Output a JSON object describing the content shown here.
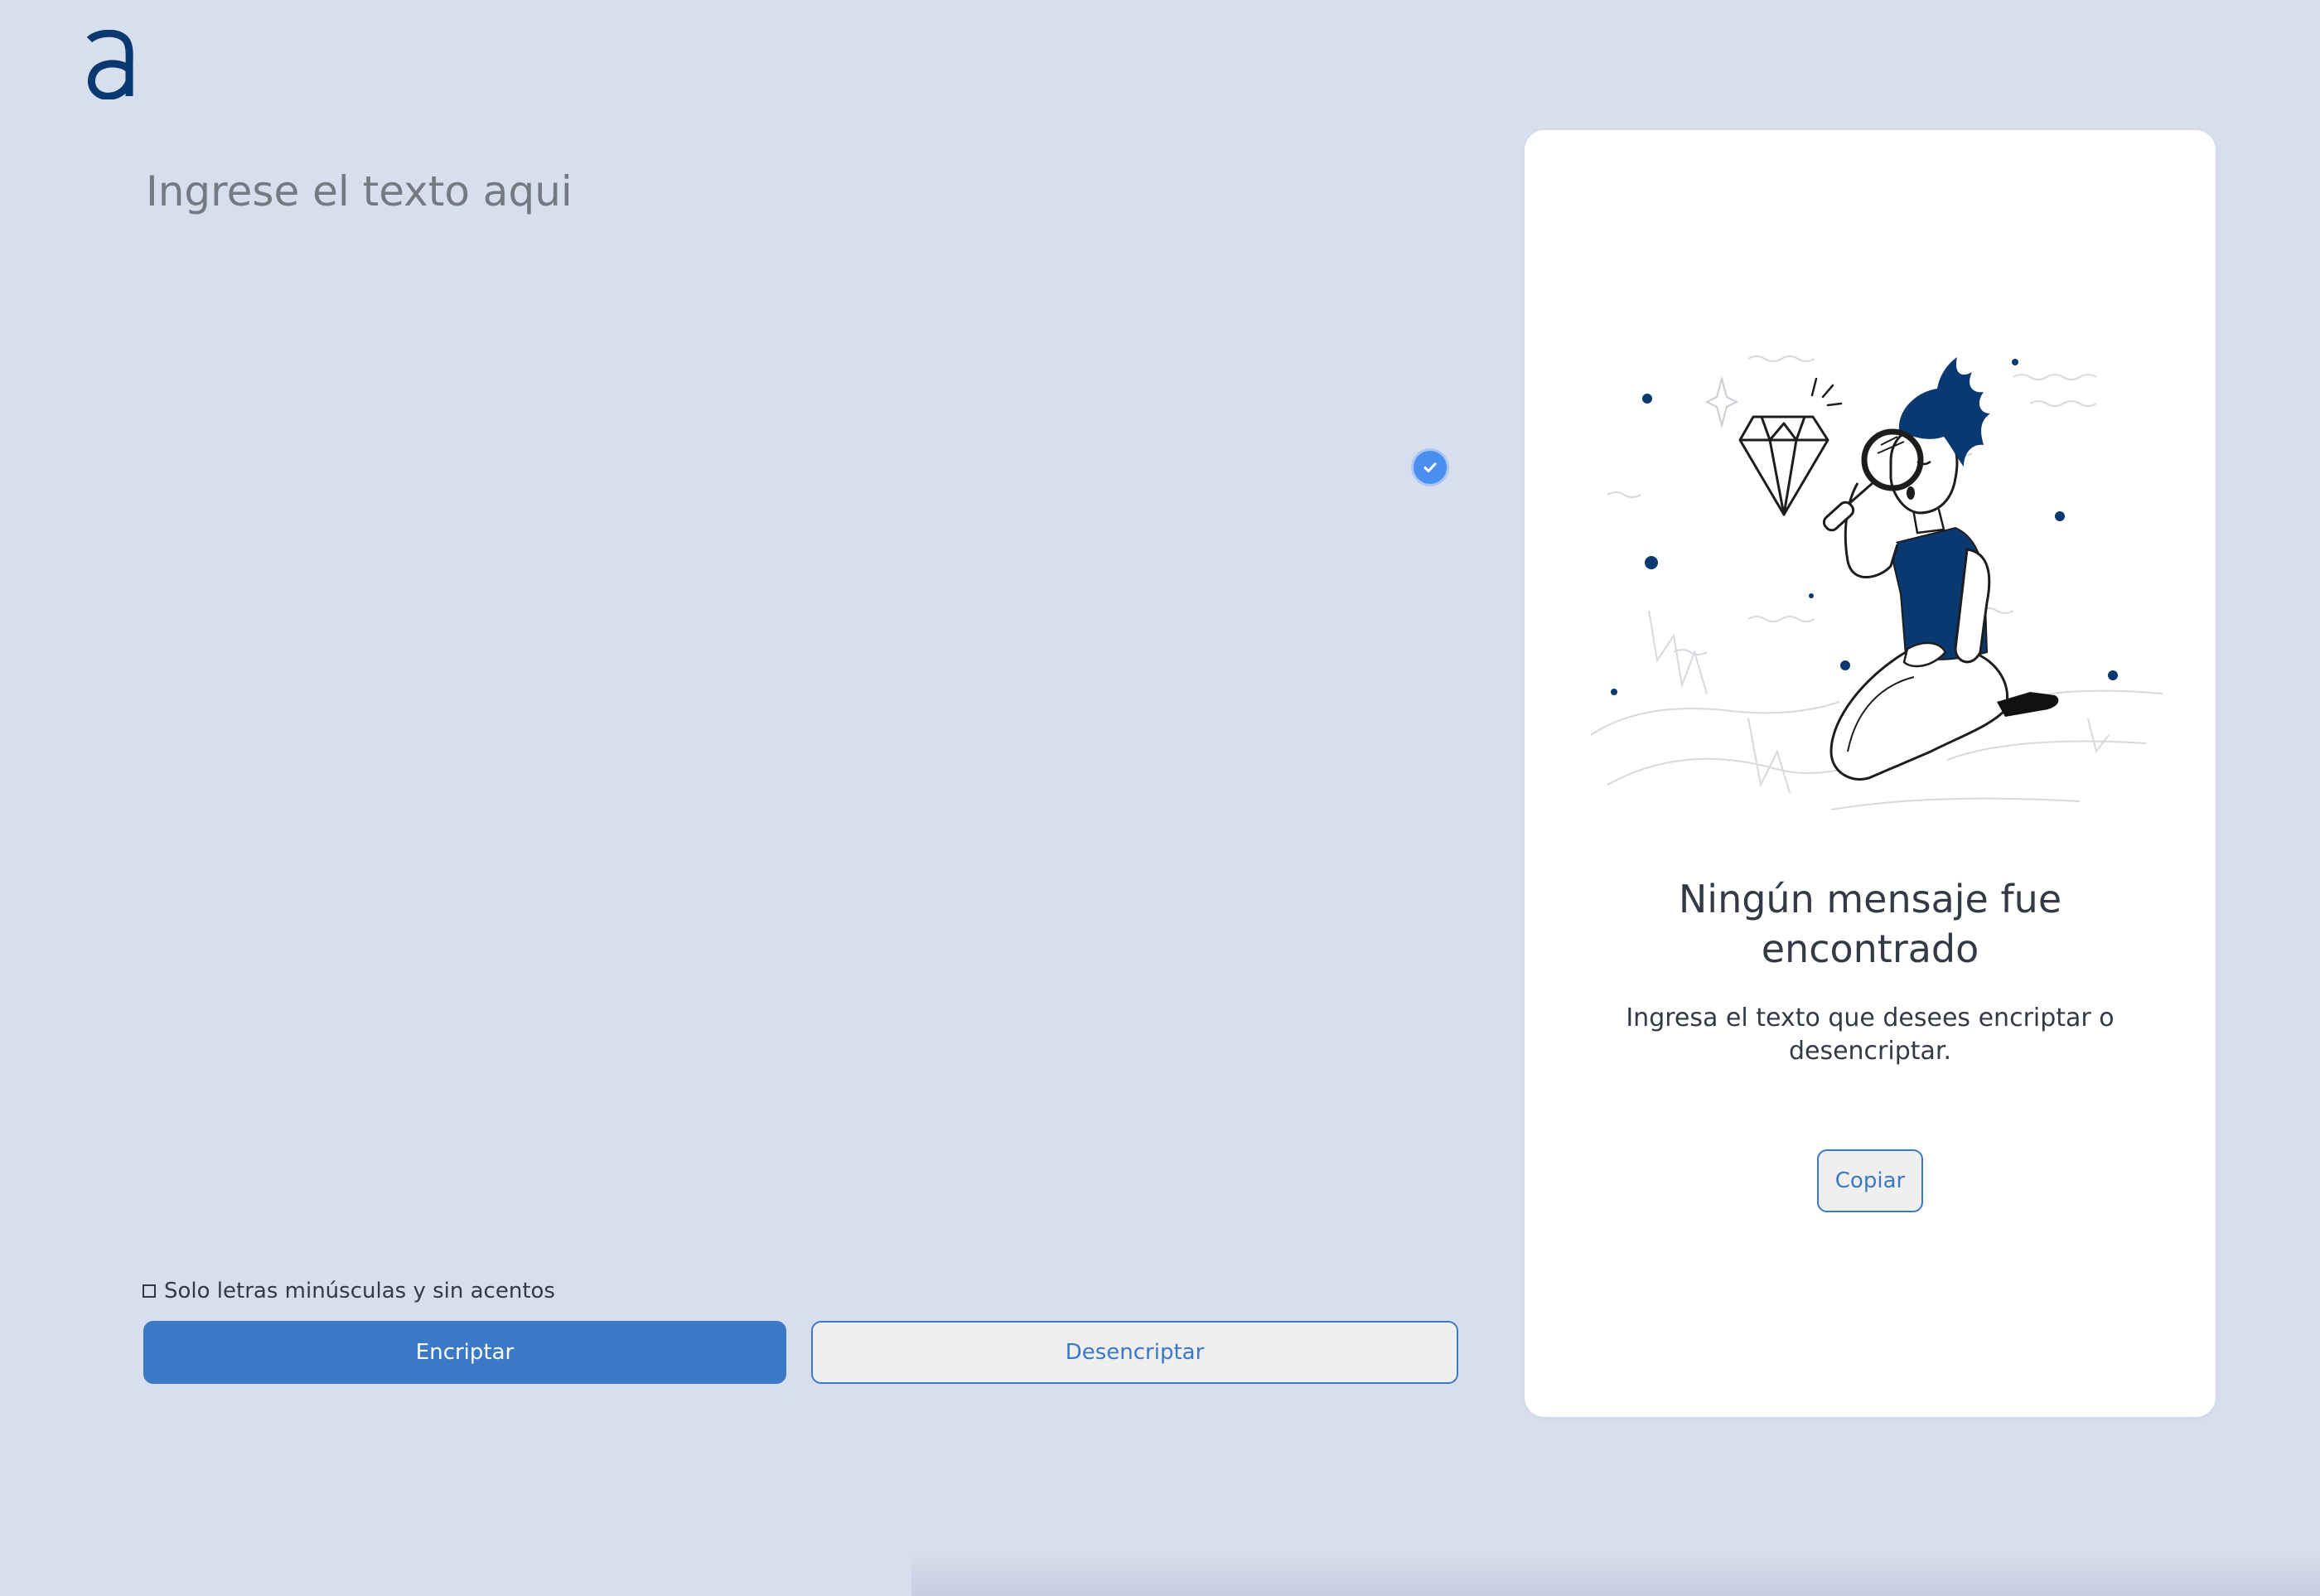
{
  "app": {
    "logo_letter": "a"
  },
  "input": {
    "placeholder": "Ingrese el texto aqui",
    "value": ""
  },
  "hint": {
    "text": "Solo letras minúsculas y sin acentos"
  },
  "actions": {
    "encrypt_label": "Encriptar",
    "decrypt_label": "Desencriptar"
  },
  "output": {
    "title": "Ningún mensaje fue encontrado",
    "description": "Ingresa el texto que desees encriptar o desencriptar.",
    "copy_label": "Copiar",
    "illustration_icon": "person-searching-diamond-illustration"
  },
  "colors": {
    "background": "#d7dfee",
    "brand_dark": "#0a3871",
    "accent": "#3b79c6",
    "card": "#ffffff",
    "text": "#343a45",
    "placeholder": "#757a82"
  }
}
